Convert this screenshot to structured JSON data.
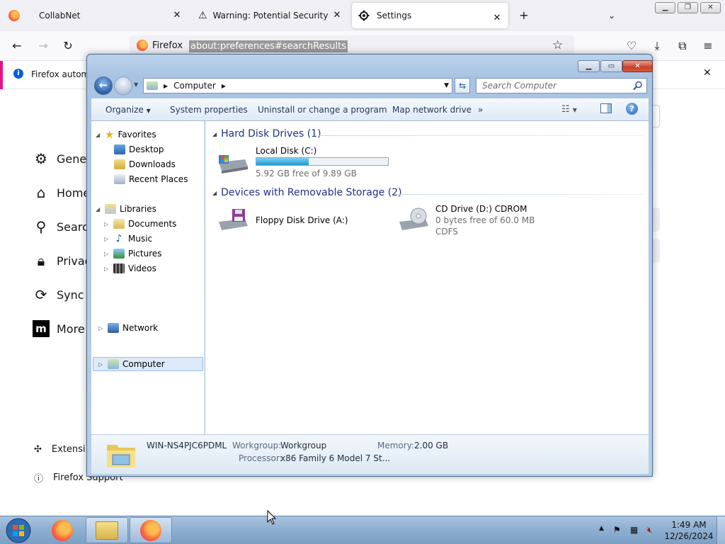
{
  "browser": {
    "tabs": [
      {
        "title": "CollabNet"
      },
      {
        "title": "Warning: Potential Security Risk"
      },
      {
        "title": "Settings"
      }
    ],
    "new_tab_symbol": "+",
    "identity_label": "Firefox",
    "url": "about:preferences#searchResults",
    "notice": "Firefox automa"
  },
  "settings": {
    "nav": [
      {
        "label": "Gener",
        "icon": "gear-icon"
      },
      {
        "label": "Home",
        "icon": "home-icon"
      },
      {
        "label": "Search",
        "icon": "search-icon"
      },
      {
        "label": "Privac",
        "icon": "lock-icon"
      },
      {
        "label": "Sync",
        "icon": "sync-icon"
      },
      {
        "label": "More",
        "icon": "mozilla-icon"
      }
    ],
    "footer": [
      {
        "label": "Extensi",
        "icon": "puzzle-icon"
      },
      {
        "label": "Firefox Support",
        "icon": "help-icon"
      }
    ]
  },
  "explorer": {
    "breadcrumb": "Computer",
    "search_placeholder": "Search Computer",
    "commands": [
      "Organize",
      "System properties",
      "Uninstall or change a program",
      "Map network drive",
      "»"
    ],
    "nav": {
      "favorites": "Favorites",
      "favorites_items": [
        "Desktop",
        "Downloads",
        "Recent Places"
      ],
      "libraries": "Libraries",
      "libraries_items": [
        "Documents",
        "Music",
        "Pictures",
        "Videos"
      ],
      "computer": "Computer",
      "network": "Network"
    },
    "groups": {
      "hdd": "Hard Disk Drives (1)",
      "removable": "Devices with Removable Storage (2)"
    },
    "drives": {
      "c": {
        "name": "Local Disk (C:)",
        "free": "5.92 GB free of 9.89 GB",
        "used_fraction": 0.4
      },
      "a": {
        "name": "Floppy Disk Drive (A:)"
      },
      "d": {
        "name": "CD Drive (D:) CDROM",
        "free": "0 bytes free of 60.0 MB",
        "fs": "CDFS"
      }
    },
    "details": {
      "computer_name": "WIN-NS4PJC6PDML",
      "workgroup_label": "Workgroup:",
      "workgroup": "Workgroup",
      "memory_label": "Memory:",
      "memory": "2.00 GB",
      "processor_label": "Processor:",
      "processor": "x86 Family 6 Model 7 St..."
    }
  },
  "taskbar": {
    "time": "1:49 AM",
    "date": "12/26/2024"
  }
}
